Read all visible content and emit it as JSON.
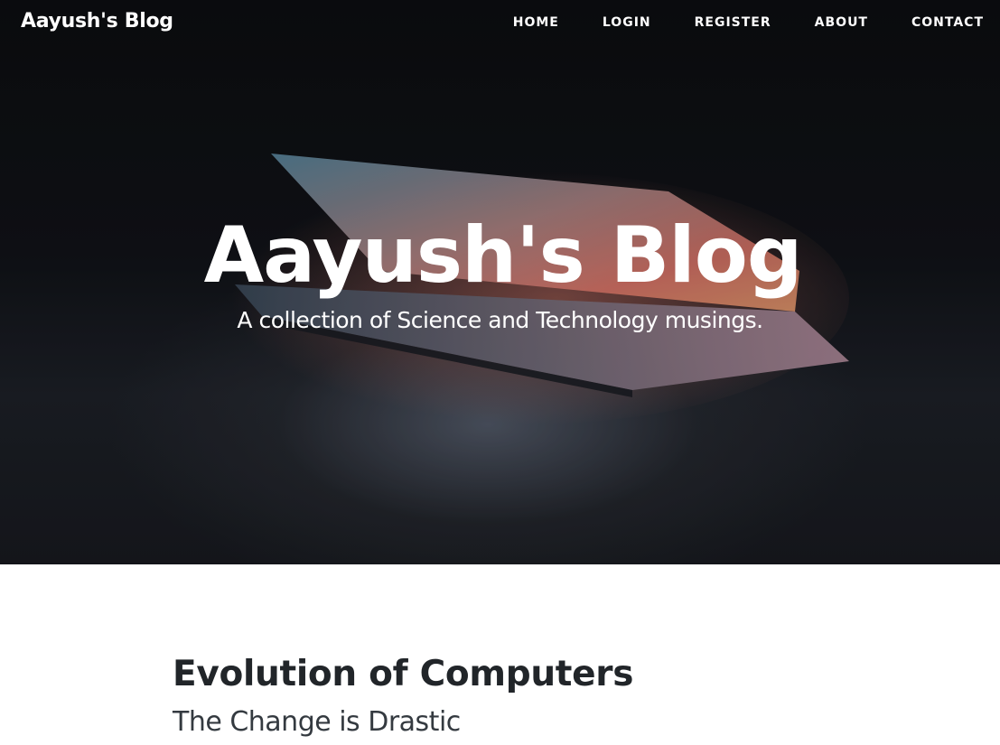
{
  "brand": {
    "name": "Aayush's Blog"
  },
  "nav": {
    "items": [
      {
        "label": "HOME"
      },
      {
        "label": "LOGIN"
      },
      {
        "label": "REGISTER"
      },
      {
        "label": "ABOUT"
      },
      {
        "label": "CONTACT"
      }
    ]
  },
  "hero": {
    "title": "Aayush's Blog",
    "subtitle": "A collection of Science and Technology musings."
  },
  "posts": [
    {
      "title": "Evolution of Computers",
      "subtitle": "The Change is Drastic"
    }
  ],
  "colors": {
    "hero_background": "#101217",
    "text_light": "#ffffff",
    "text_dark": "#212529"
  }
}
